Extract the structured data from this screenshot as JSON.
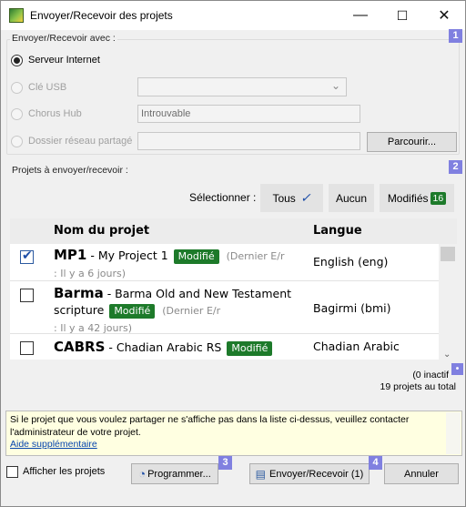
{
  "window": {
    "title": "Envoyer/Recevoir des projets",
    "minimize": "—",
    "maximize": "☐",
    "close": "✕"
  },
  "send_with": {
    "label": "Envoyer/Recevoir avec :",
    "badge": "1",
    "internet": "Serveur Internet",
    "usb": "Clé USB",
    "chorus": "Chorus Hub",
    "chorus_value": "Introuvable",
    "network": "Dossier réseau partagé",
    "browse": "Parcourir..."
  },
  "projects": {
    "label": "Projets à envoyer/recevoir :",
    "badge": "2",
    "select_label": "Sélectionner :",
    "all": "Tous",
    "none": "Aucun",
    "modified": "Modifiés",
    "modified_count": "16",
    "col_name": "Nom du projet",
    "col_lang": "Langue",
    "rows": [
      {
        "code": "MP1",
        "name": " - My Project 1",
        "badge": "Modifié",
        "last": "(Dernier E/r",
        "ago": ": Il y a 6 jours)",
        "lang": "English (eng)",
        "checked": true
      },
      {
        "code": "Barma",
        "name": " - Barma Old and New Testament scripture",
        "badge": "Modifié",
        "last": "(Dernier E/r",
        "ago": ": Il y a 42 jours)",
        "lang": "Bagirmi (bmi)",
        "checked": false
      },
      {
        "code": "CABRS",
        "name": " - Chadian Arabic RS",
        "badge": "Modifié",
        "last": "",
        "ago": "",
        "lang": "Chadian Arabic",
        "checked": false
      }
    ],
    "inactive": "(0 inactif",
    "total": "19 projets au total"
  },
  "info": {
    "message": "Si le projet que vous voulez partager ne s'affiche pas dans la liste ci-dessus, veuillez contacter l'administrateur de votre projet.",
    "help": "Aide supplémentaire"
  },
  "footer": {
    "show_projects": "Afficher les projets",
    "schedule": "Programmer...",
    "schedule_badge": "3",
    "send_receive": "Envoyer/Recevoir (1)",
    "send_badge": "4",
    "cancel": "Annuler"
  },
  "colors": {
    "accent_badge": "#8080e0",
    "modified_green": "#1d7a2a",
    "check_blue": "#1f4fa8",
    "info_yellow": "#ffffe1"
  }
}
